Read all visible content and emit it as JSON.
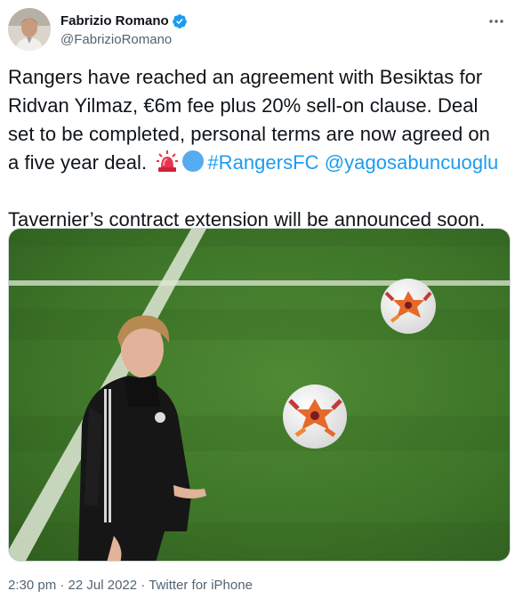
{
  "author": {
    "display_name": "Fabrizio Romano",
    "handle": "@FabrizioRomano"
  },
  "tweet": {
    "line1": "Rangers have reached an agreement with Besiktas for",
    "line2": "Ridvan Yilmaz, €6m fee plus 20% sell-on clause. Deal",
    "line3": "set to be completed, personal terms are now agreed on",
    "line4_text": "a five year deal.",
    "hashtag": "#RangersFC",
    "mention": "@yagosabuncuoglu",
    "line5": "Tavernier’s contract extension will be announced soon."
  },
  "meta": {
    "time": "2:30 pm",
    "sep1": "·",
    "date": "22 Jul 2022",
    "sep2": "·",
    "source": "Twitter for iPhone"
  },
  "icons": {
    "verified": "verified-badge-icon",
    "more": "more-options-icon",
    "siren": "police-light-emoji",
    "blue_circle": "blue-circle-emoji"
  },
  "colors": {
    "link": "#1d9bf0",
    "text": "#0f1419",
    "secondary": "#536471"
  }
}
